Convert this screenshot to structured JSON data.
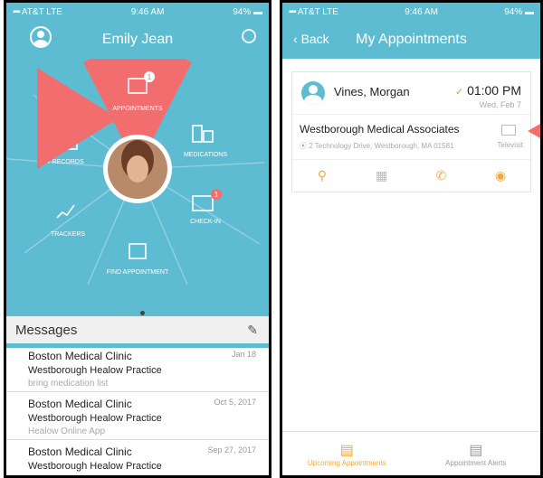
{
  "colors": {
    "teal": "#5dbcd2",
    "salmon": "#f26d6d",
    "orange": "#f2a93b",
    "white": "#ffffff"
  },
  "status_left": {
    "carrier": "AT&T",
    "net": "LTE",
    "time": "9:46 AM",
    "battery": "94%"
  },
  "status_right": {
    "carrier": "AT&T",
    "net": "LTE",
    "time": "9:46 AM",
    "battery": "94%"
  },
  "home": {
    "user_name": "Emily Jean",
    "wheel": {
      "appointments": "APPOINTMENTS",
      "appointments_badge": "1",
      "medications": "MEDICATIONS",
      "checkin": "CHECK-IN",
      "checkin_badge": "1",
      "find": "FIND APPOINTMENT",
      "trackers": "TRACKERS",
      "records": "MY RECORDS"
    },
    "messages_title": "Messages",
    "messages": [
      {
        "clinic": "Boston Medical Clinic",
        "date": "Jan 18",
        "practice": "Westborough Healow Practice",
        "preview": "bring medication list"
      },
      {
        "clinic": "Boston Medical Clinic",
        "date": "Oct 5, 2017",
        "practice": "Westborough Healow Practice",
        "preview": "Healow Online App"
      },
      {
        "clinic": "Boston Medical Clinic",
        "date": "Sep 27, 2017",
        "practice": "Westborough Healow Practice",
        "preview": ""
      }
    ]
  },
  "appointments": {
    "back": "Back",
    "title": "My Appointments",
    "provider": "Vines, Morgan",
    "time": "01:00 PM",
    "date": "Wed, Feb 7",
    "facility": "Westborough Medical Associates",
    "address": "2 Technology Drive, Westborough, MA 01581",
    "visit_type": "Televisit",
    "tabs": {
      "upcoming": "Upcoming Appointments",
      "alerts": "Appointment Alerts"
    }
  }
}
